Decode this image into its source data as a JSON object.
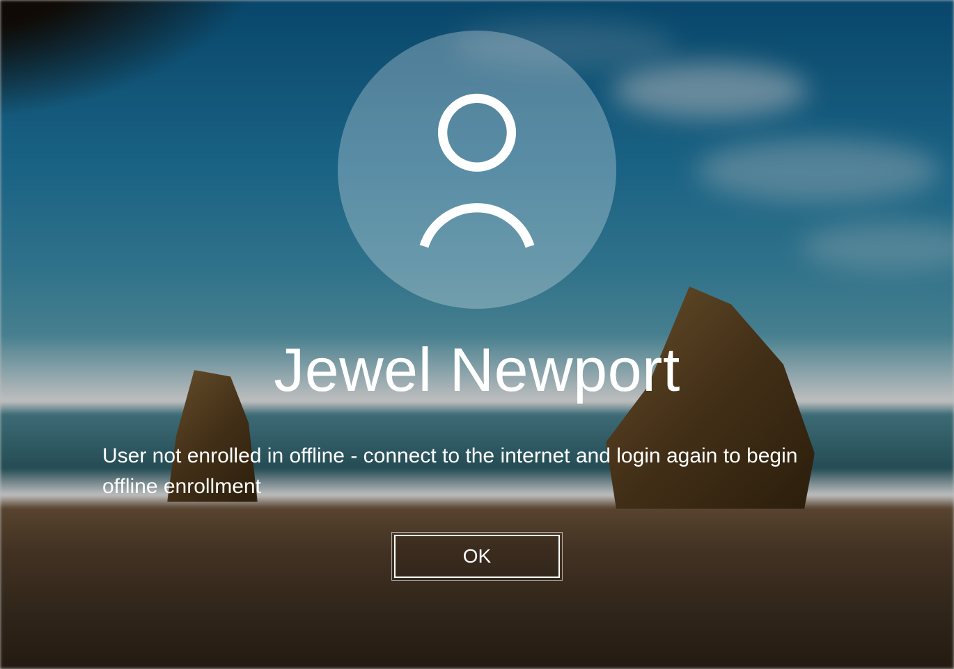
{
  "login": {
    "username": "Jewel Newport",
    "message": "User not enrolled in offline - connect to the internet and login again to begin offline enrollment",
    "ok_label": "OK"
  }
}
